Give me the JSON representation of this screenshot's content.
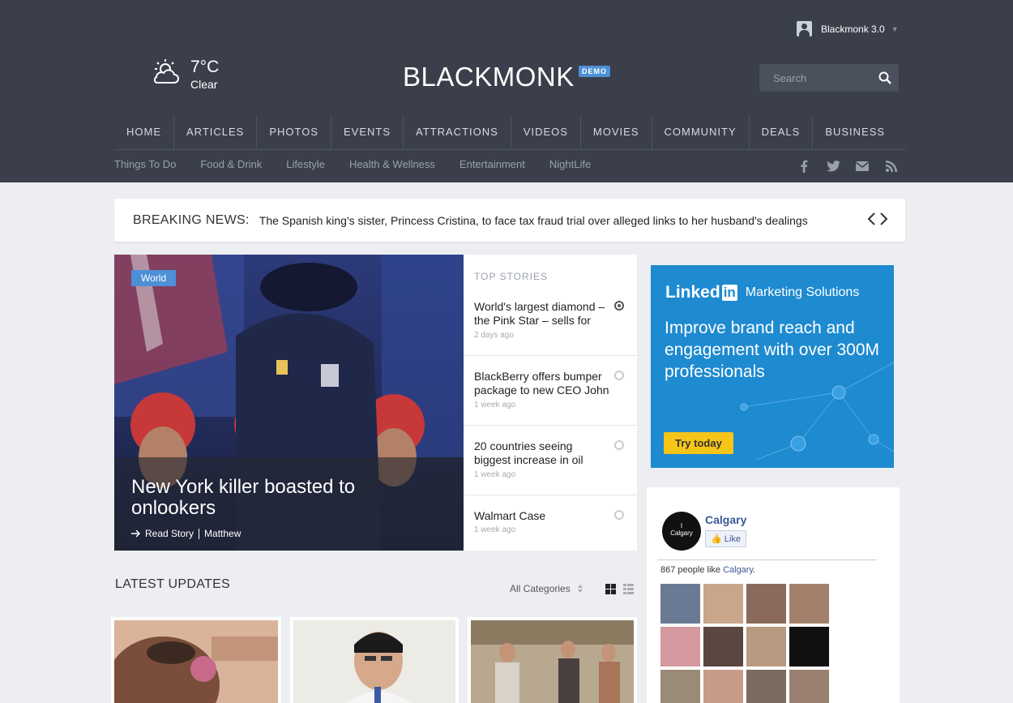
{
  "user": {
    "name": "Blackmonk 3.0"
  },
  "weather": {
    "temp": "7°C",
    "desc": "Clear"
  },
  "logo": {
    "text": "BLACKMONK",
    "badge": "DEMO"
  },
  "search": {
    "placeholder": "Search"
  },
  "nav": [
    "HOME",
    "ARTICLES",
    "PHOTOS",
    "EVENTS",
    "ATTRACTIONS",
    "VIDEOS",
    "MOVIES",
    "COMMUNITY",
    "DEALS",
    "BUSINESS"
  ],
  "subnav": [
    "Things To Do",
    "Food & Drink",
    "Lifestyle",
    "Health & Wellness",
    "Entertainment",
    "NightLife"
  ],
  "breaking": {
    "label": "BREAKING NEWS:",
    "text": "The Spanish king's sister, Princess Cristina, to face tax fraud trial over alleged links to her husband's dealings"
  },
  "feature": {
    "badge": "World",
    "title": "New York killer boasted to onlookers",
    "read": "Read Story",
    "author": "Matthew"
  },
  "top_stories": {
    "header": "TOP STORIES",
    "items": [
      {
        "title": "World's largest diamond – the Pink Star – sells for",
        "time": "2 days ago"
      },
      {
        "title": "BlackBerry offers bumper package to new CEO John",
        "time": "1 week ago"
      },
      {
        "title": "20 countries seeing biggest increase in oil",
        "time": "1 week ago"
      },
      {
        "title": "Walmart Case",
        "time": "1 week ago"
      }
    ]
  },
  "latest": {
    "title": "LATEST UPDATES",
    "filter": "All Categories"
  },
  "ad": {
    "brand": "Linked",
    "brand_in": "in",
    "tagline": "Marketing Solutions",
    "headline": "Improve brand reach and engagement with over 300M professionals",
    "cta": "Try today"
  },
  "fb": {
    "page": "Calgary",
    "like": "Like",
    "count_prefix": "867 people like ",
    "count_page": "Calgary",
    "count_suffix": ".",
    "logo_line1": "I",
    "logo_line2": "Calgary"
  }
}
